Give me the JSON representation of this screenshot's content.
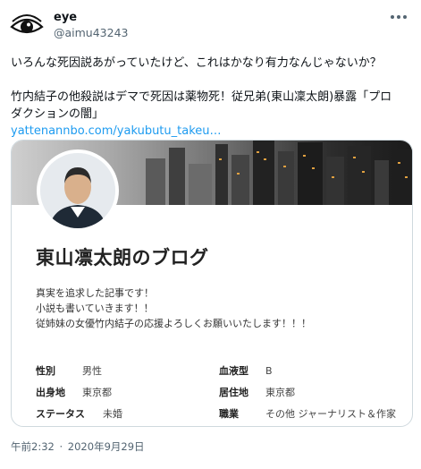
{
  "author": {
    "name": "eye",
    "handle": "@aimu43243",
    "avatar_icon": "eye-avatar-icon"
  },
  "more_icon": "more-horizontal-icon",
  "tweet": {
    "line1": "いろんな死因説あがっていたけど、これはかなり有力なんじゃないか？",
    "line2": "竹内結子の他殺説はデマで死因は薬物死！従兄弟(東山凜太朗)暴露「プロ",
    "line3": "ダクションの闇」",
    "link": "yattenannbo.com/yakubutu_takeu…"
  },
  "card": {
    "title": "東山凛太朗のブログ",
    "description": [
      "真実を追求した記事です！",
      "小説も書いていきます！！",
      "従姉妹の女優竹内結子の応援よろしくお願いいたします！！！"
    ],
    "profile": [
      {
        "label": "性別",
        "value": "男性",
        "label2": "血液型",
        "value2": "B"
      },
      {
        "label": "出身地",
        "value": "東京都",
        "label2": "居住地",
        "value2": "東京都"
      },
      {
        "label": "ステータス",
        "value": "未婚",
        "label2": "職業",
        "value2": "その他 ジャーナリスト＆作家"
      }
    ]
  },
  "timestamp": {
    "time": "午前2:32",
    "separator": "·",
    "date": "2020年9月29日"
  }
}
